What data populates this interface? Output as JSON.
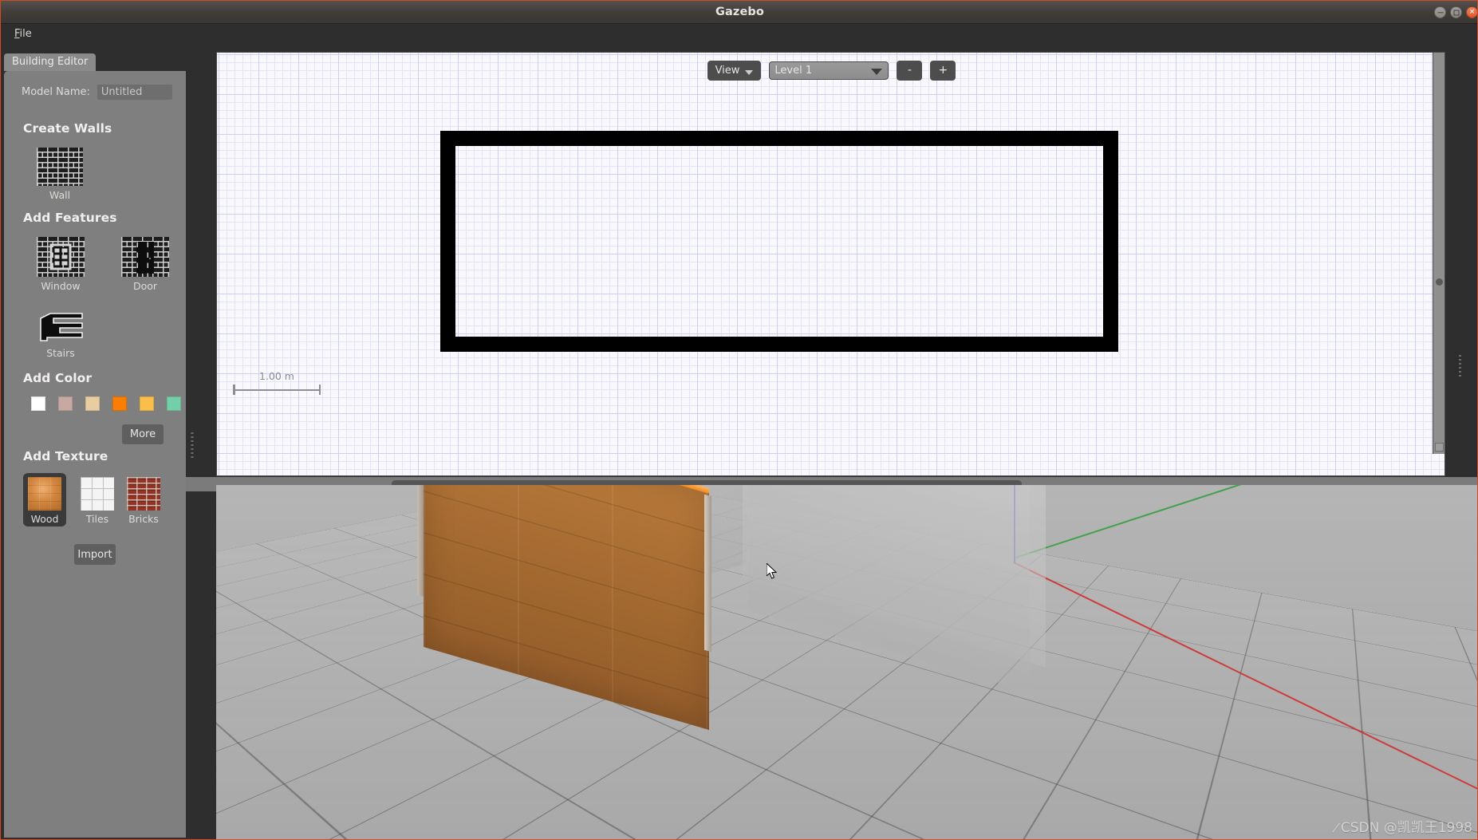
{
  "window": {
    "title": "Gazebo",
    "controls": {
      "minimize": "minimize-button",
      "maximize": "maximize-button",
      "close": "close-button"
    }
  },
  "menubar": {
    "items": [
      {
        "label": "File",
        "accelerator": "F"
      }
    ]
  },
  "panel": {
    "tab_label": "Building Editor",
    "help_glyph": "?",
    "model_name": {
      "label": "Model Name:",
      "value": "Untitled",
      "placeholder": "Untitled"
    },
    "sections": {
      "create_walls": {
        "heading": "Create Walls",
        "items": [
          {
            "label": "Wall",
            "icon": "brick-wall-icon"
          }
        ]
      },
      "add_features": {
        "heading": "Add Features",
        "items": [
          {
            "label": "Window",
            "icon": "window-icon"
          },
          {
            "label": "Door",
            "icon": "door-icon"
          },
          {
            "label": "Stairs",
            "icon": "stairs-icon"
          }
        ]
      },
      "add_color": {
        "heading": "Add Color",
        "swatches": [
          {
            "name": "white",
            "hex": "#ffffff"
          },
          {
            "name": "rose",
            "hex": "#c7a9a2"
          },
          {
            "name": "tan",
            "hex": "#e8cda1"
          },
          {
            "name": "orange",
            "hex": "#fb7d04"
          },
          {
            "name": "amber",
            "hex": "#fcbe4a"
          },
          {
            "name": "mint",
            "hex": "#73cfa7"
          }
        ],
        "more_label": "More"
      },
      "add_texture": {
        "heading": "Add Texture",
        "items": [
          {
            "label": "Wood",
            "selected": true
          },
          {
            "label": "Tiles",
            "selected": false
          },
          {
            "label": "Bricks",
            "selected": false
          }
        ],
        "import_label": "Import"
      }
    }
  },
  "view2d": {
    "toolbar": {
      "view_label": "View",
      "level_value": "Level 1",
      "zoom_out_label": "-",
      "zoom_in_label": "+"
    },
    "scale_label": "1.00 m"
  },
  "view3d": {
    "cursor": "mouse-pointer"
  },
  "watermark": {
    "text": "CSDN @凯凯王1998"
  }
}
